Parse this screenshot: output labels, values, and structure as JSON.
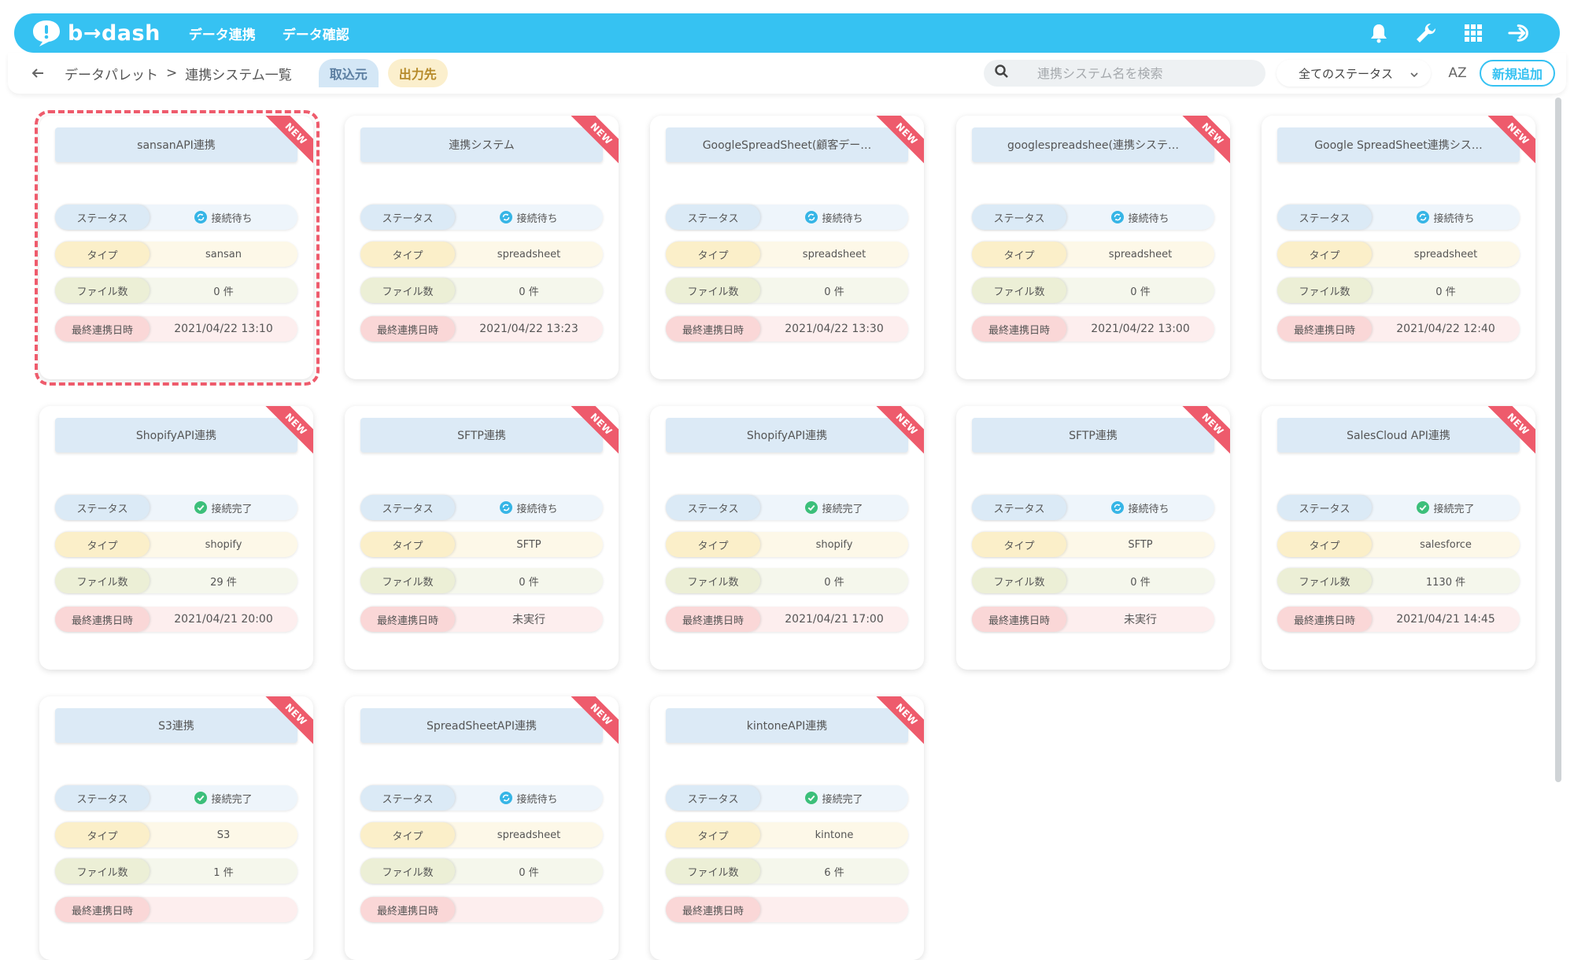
{
  "header": {
    "logo": "b→dash",
    "nav": [
      "データ連携",
      "データ確認"
    ]
  },
  "subbar": {
    "breadcrumb": [
      "データパレット",
      "連携システム一覧"
    ],
    "breadcrumb_sep": ">",
    "tabs": [
      "取込元",
      "出力先"
    ],
    "search_placeholder": "連携システム名を検索",
    "status_filter": "全てのステータス",
    "sort_label": "AZ",
    "add_button": "新規追加"
  },
  "labels": {
    "status": "ステータス",
    "type": "タイプ",
    "files": "ファイル数",
    "last_sync": "最終連携日時",
    "new_badge": "NEW"
  },
  "colors": {
    "brand": "#36c2f2",
    "new_ribbon": "#ee5b6c",
    "status_waiting": "#36b5e6",
    "status_done": "#3cbf7a"
  },
  "cards": [
    {
      "name": "sansanAPI連携",
      "status": "接続待ち",
      "status_kind": "waiting",
      "type": "sansan",
      "files": "0 件",
      "last_sync": "2021/04/22 13:10",
      "selected": true
    },
    {
      "name": "連携システム",
      "status": "接続待ち",
      "status_kind": "waiting",
      "type": "spreadsheet",
      "files": "0 件",
      "last_sync": "2021/04/22 13:23"
    },
    {
      "name": "GoogleSpreadSheet(顧客デー…",
      "status": "接続待ち",
      "status_kind": "waiting",
      "type": "spreadsheet",
      "files": "0 件",
      "last_sync": "2021/04/22 13:30"
    },
    {
      "name": "googlespreadshee(連携システ…",
      "status": "接続待ち",
      "status_kind": "waiting",
      "type": "spreadsheet",
      "files": "0 件",
      "last_sync": "2021/04/22 13:00"
    },
    {
      "name": "Google SpreadSheet連携シス…",
      "status": "接続待ち",
      "status_kind": "waiting",
      "type": "spreadsheet",
      "files": "0 件",
      "last_sync": "2021/04/22 12:40"
    },
    {
      "name": "ShopifyAPI連携",
      "status": "接続完了",
      "status_kind": "done",
      "type": "shopify",
      "files": "29 件",
      "last_sync": "2021/04/21 20:00"
    },
    {
      "name": "SFTP連携",
      "status": "接続待ち",
      "status_kind": "waiting",
      "type": "SFTP",
      "files": "0 件",
      "last_sync": "未実行"
    },
    {
      "name": "ShopifyAPI連携",
      "status": "接続完了",
      "status_kind": "done",
      "type": "shopify",
      "files": "0 件",
      "last_sync": "2021/04/21 17:00"
    },
    {
      "name": "SFTP連携",
      "status": "接続待ち",
      "status_kind": "waiting",
      "type": "SFTP",
      "files": "0 件",
      "last_sync": "未実行"
    },
    {
      "name": "SalesCloud API連携",
      "status": "接続完了",
      "status_kind": "done",
      "type": "salesforce",
      "files": "1130 件",
      "last_sync": "2021/04/21 14:45"
    },
    {
      "name": "S3連携",
      "status": "接続完了",
      "status_kind": "done",
      "type": "S3",
      "files": "1 件",
      "last_sync": ""
    },
    {
      "name": "SpreadSheetAPI連携",
      "status": "接続待ち",
      "status_kind": "waiting",
      "type": "spreadsheet",
      "files": "0 件",
      "last_sync": ""
    },
    {
      "name": "kintoneAPI連携",
      "status": "接続完了",
      "status_kind": "done",
      "type": "kintone",
      "files": "6 件",
      "last_sync": ""
    }
  ]
}
